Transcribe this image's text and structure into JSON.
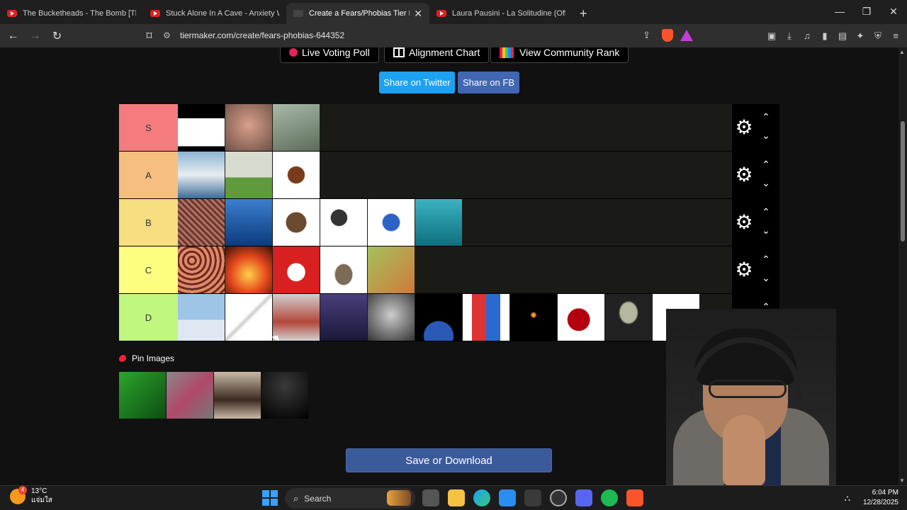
{
  "browser": {
    "tabs": [
      {
        "title": "The Bucketheads - The Bomb [These",
        "active": false,
        "favicon": "youtube-icon"
      },
      {
        "title": "Stuck Alone In A Cave - Anxiety Warn",
        "active": false,
        "favicon": "youtube-icon"
      },
      {
        "title": "Create a Fears/Phobias Tier List",
        "active": true,
        "favicon": "tiermaker-icon"
      },
      {
        "title": "Laura Pausini - La Solitudine (Official",
        "active": false,
        "favicon": "youtube-icon"
      }
    ],
    "new_tab": "+",
    "url": "tiermaker.com/create/fears-phobias-644352"
  },
  "page": {
    "top_buttons": {
      "live_voting": "Live Voting Poll",
      "alignment": "Alignment Chart",
      "community": "View Community Rank"
    },
    "share_twitter": "Share on Twitter",
    "share_fb": "Share on FB",
    "tiers": [
      {
        "label": "S",
        "color": "#f47c7f",
        "items": [
          "window-silhouette",
          "screaming-girl",
          "glass-floor-heights"
        ]
      },
      {
        "label": "A",
        "color": "#f7bf7f",
        "items": [
          "shark",
          "gravestone",
          "cockroach"
        ]
      },
      {
        "label": "B",
        "color": "#f7de80",
        "items": [
          "crowd",
          "deep-ocean",
          "tarantula",
          "microphone",
          "virus",
          "jellyfish-diver"
        ]
      },
      {
        "label": "C",
        "color": "#fdfd7f",
        "items": [
          "lotus-holes",
          "house-fire",
          "clown",
          "mouse",
          "lizard"
        ]
      },
      {
        "label": "D",
        "color": "#c0f77f",
        "items": [
          "airplane",
          "syringe",
          "tinman-robot",
          "lightning-storm",
          "man-portrait",
          "asteroid-earth",
          "knotted-rope",
          "candle-dark",
          "blood-splatter",
          "alien",
          "worm"
        ]
      }
    ],
    "pin_label": "Pin Images",
    "pool_items": [
      "green-snake",
      "centipede",
      "scorpion-hand",
      "darkness"
    ],
    "save_button": "Save or Download"
  },
  "taskbar": {
    "weather_temp": "13°C",
    "weather_desc": "แจ่มใส",
    "weather_badge": "4",
    "search_placeholder": "Search",
    "time": "6:04 PM",
    "date": "12/28/2025"
  }
}
